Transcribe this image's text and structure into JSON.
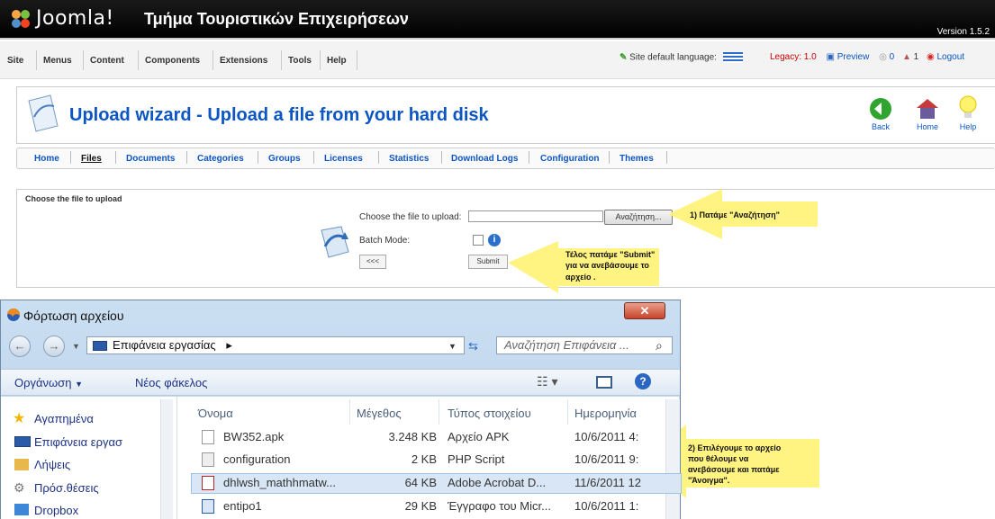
{
  "header": {
    "brand": "Joomla!",
    "site_name": "Τμήμα Τουριστικών Επιχειρήσεων",
    "version": "Version 1.5.2"
  },
  "menu": {
    "items": [
      "Site",
      "Menus",
      "Content",
      "Components",
      "Extensions",
      "Tools",
      "Help"
    ],
    "language_label": "Site default language:",
    "legacy": "Legacy: 1.0",
    "preview": "Preview",
    "messages_count": "0",
    "users_count": "1",
    "logout": "Logout"
  },
  "toolbar": {
    "title": "Upload wizard - Upload a file from your hard disk",
    "back": "Back",
    "home": "Home",
    "help": "Help"
  },
  "nav": {
    "items": [
      "Home",
      "Files",
      "Documents",
      "Categories",
      "Groups",
      "Licenses",
      "Statistics",
      "Download Logs",
      "Configuration",
      "Themes"
    ]
  },
  "upload": {
    "heading": "Choose the file to upload",
    "file_label": "Choose the file to upload:",
    "file_value": "",
    "browse_label": "Αναζήτηση...",
    "batch_label": "Batch Mode:",
    "back_btn": "<<<",
    "submit_btn": "Submit"
  },
  "callouts": {
    "step1": "1) Πατάμε \"Αναζήτηση\"",
    "step3_line1": "Τέλος πατάμε \"Submit\"",
    "step3_line2": "για να ανεβάσουμε το",
    "step3_line3": "αρχείο .",
    "step2_line1": "2) Επιλέγουμε το αρχείο",
    "step2_line2": "που θέλουμε να",
    "step2_line3": "ανεβάσουμε και πατάμε",
    "step2_line4": "\"Άνοιγμα\"."
  },
  "dialog": {
    "title": "Φόρτωση αρχείου",
    "address": "Επιφάνεια εργασίας",
    "search_placeholder": "Αναζήτηση Επιφάνεια ...",
    "organize": "Οργάνωση",
    "new_folder": "Νέος φάκελος",
    "nav_items": [
      "Αγαπημένα",
      "Επιφάνεια εργασ",
      "Λήψεις",
      "Πρόσ.θέσεις",
      "Dropbox"
    ],
    "columns": [
      "Όνομα",
      "Μέγεθος",
      "Τύπος στοιχείου",
      "Ημερομηνία"
    ],
    "files": [
      {
        "name": "BW352.apk",
        "size": "3.248 KB",
        "type": "Αρχείο APK",
        "date": "10/6/2011 4:"
      },
      {
        "name": "configuration",
        "size": "2 KB",
        "type": "PHP Script",
        "date": "10/6/2011 9:"
      },
      {
        "name": "dhlwsh_mathhmatw...",
        "size": "64 KB",
        "type": "Adobe Acrobat D...",
        "date": "11/6/2011 12"
      },
      {
        "name": "entipo1",
        "size": "29 KB",
        "type": "Έγγραφο του Micr...",
        "date": "10/6/2011 1:"
      }
    ]
  },
  "colors": {
    "joomla_blue": "#0b55c4",
    "callout_yellow": "#fff27a",
    "selection": "#d8e6f5"
  }
}
